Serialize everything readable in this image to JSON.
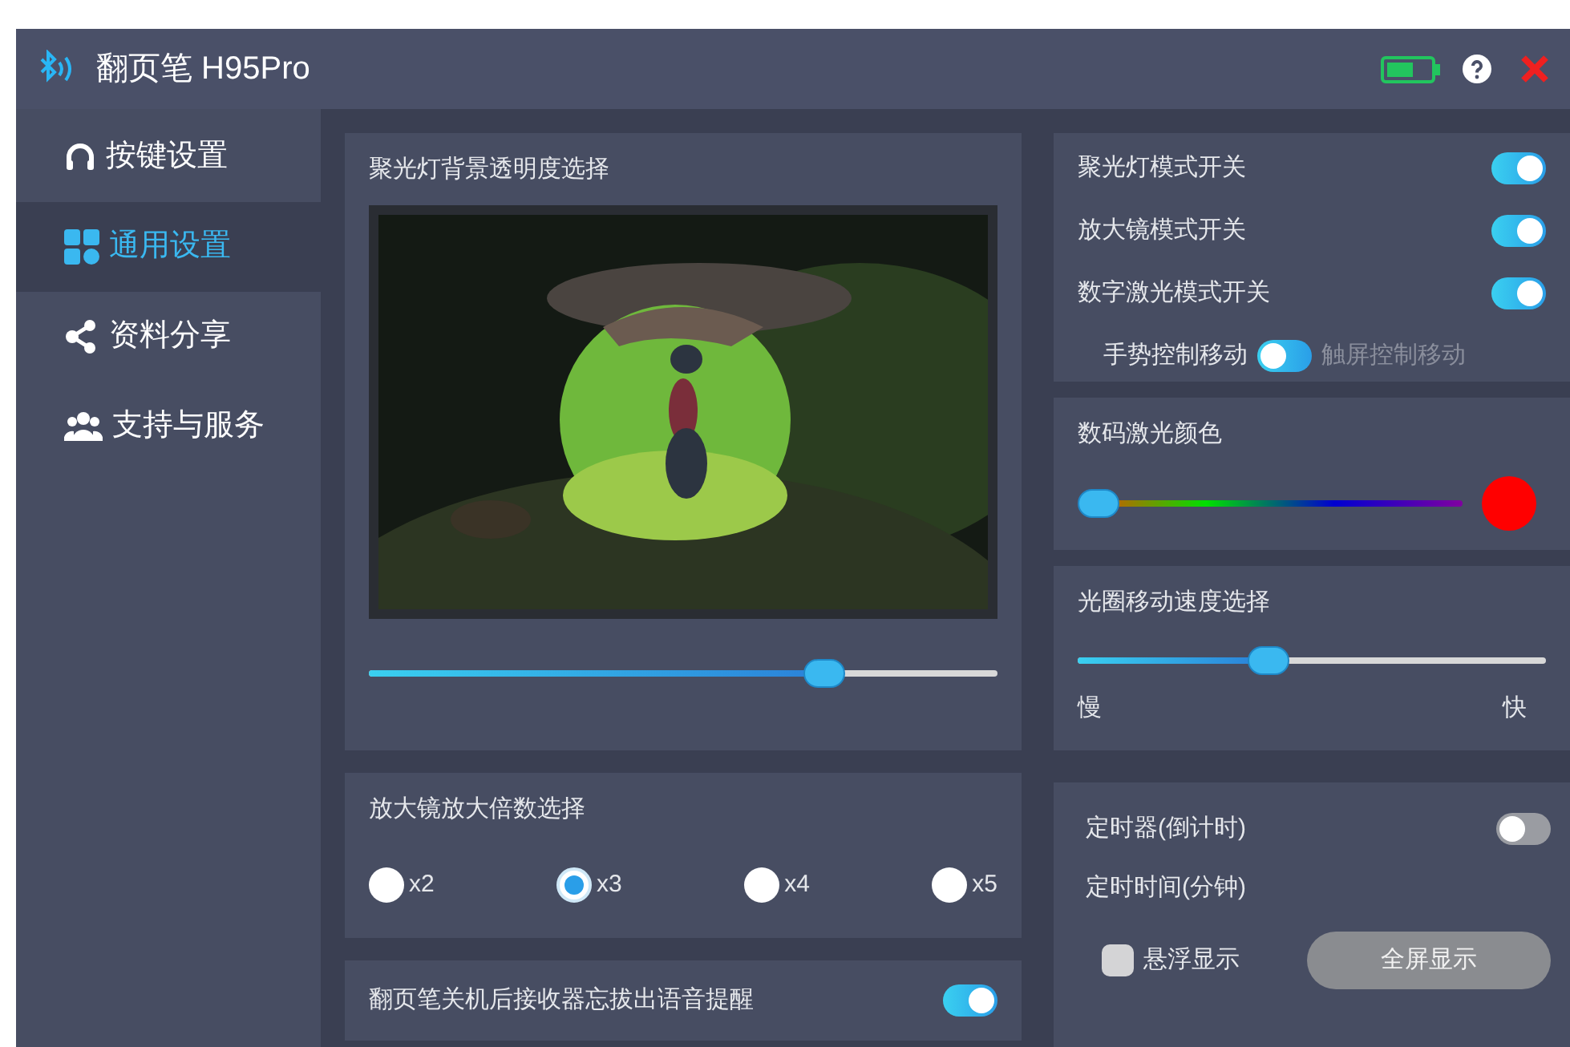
{
  "window": {
    "title": "翻页笔 H95Pro"
  },
  "sidebar": {
    "items": [
      {
        "label": "按键设置",
        "selected": false
      },
      {
        "label": "通用设置",
        "selected": true
      },
      {
        "label": "资料分享",
        "selected": false
      },
      {
        "label": "支持与服务",
        "selected": false
      }
    ]
  },
  "spotlight_opacity": {
    "title": "聚光灯背景透明度选择",
    "level": 0.74
  },
  "modes": {
    "switches": [
      {
        "label": "聚光灯模式开关",
        "on": true
      },
      {
        "label": "放大镜模式开关",
        "on": true
      },
      {
        "label": "数字激光模式开关",
        "on": true
      }
    ],
    "move_control": {
      "left_label": "手势控制移动",
      "right_label": "触屏控制移动",
      "right_selected": false
    }
  },
  "laser_color": {
    "title": "数码激光颜色",
    "level": 0.0,
    "color": "#ff0000"
  },
  "circle_speed": {
    "title": "光圈移动速度选择",
    "level": 0.4,
    "min_label": "慢",
    "max_label": "快"
  },
  "zoom": {
    "title": "放大镜放大倍数选择",
    "options": [
      {
        "label": "x2",
        "selected": false
      },
      {
        "label": "x3",
        "selected": true
      },
      {
        "label": "x4",
        "selected": false
      },
      {
        "label": "x5",
        "selected": false
      }
    ]
  },
  "receiver_reminder": {
    "label": "翻页笔关机后接收器忘拔出语音提醒",
    "on": true
  },
  "timer": {
    "label": "定时器(倒计时)",
    "on": false,
    "time_label": "定时时间(分钟)",
    "float_label": "悬浮显示",
    "float_checked": false,
    "fullscreen_button": "全屏显示"
  }
}
